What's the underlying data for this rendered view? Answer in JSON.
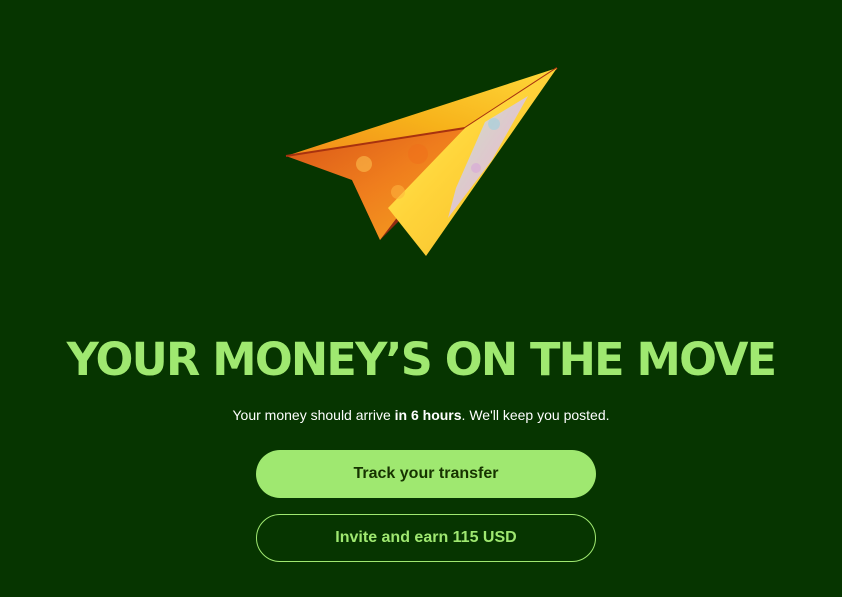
{
  "headline": "YOUR MONEY’S ON THE MOVE",
  "subtitle": {
    "before": "Your money should arrive ",
    "emphasis": "in 6 hours",
    "after": ". We'll keep you posted."
  },
  "buttons": {
    "primary_label": "Track your transfer",
    "secondary_label": "Invite and earn 115 USD"
  },
  "colors": {
    "background": "#063500",
    "accent": "#9fe870",
    "primary_text": "#163300"
  },
  "illustration": "paper-plane-icon"
}
